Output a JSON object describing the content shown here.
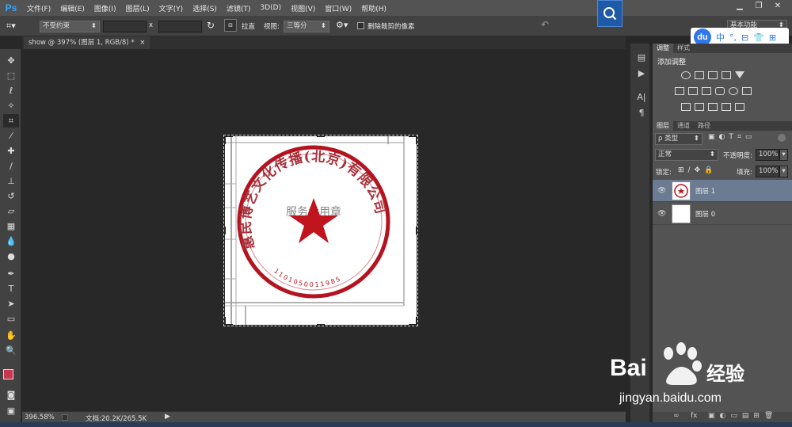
{
  "app": {
    "logo": "Ps"
  },
  "menu": [
    "文件(F)",
    "编辑(E)",
    "图像(I)",
    "图层(L)",
    "文字(Y)",
    "选择(S)",
    "滤镜(T)",
    "3D(D)",
    "视图(V)",
    "窗口(W)",
    "帮助(H)"
  ],
  "window_controls": [
    "▁",
    "❐",
    "✕"
  ],
  "options": {
    "ratio": "不受约束",
    "times": "x",
    "straighten": "拉直",
    "view_label": "视图:",
    "view_value": "三等分",
    "delete_cropped": "删除裁剪的像素",
    "workspace": "基本功能"
  },
  "document": {
    "tab": "show @ 397% (图层 1, RGB/8) *",
    "close": "×"
  },
  "status": {
    "zoom": "396.58%",
    "doc": "文档:20.2K/265.5K"
  },
  "du_bar": {
    "logo": "du",
    "items": [
      "中",
      "°,",
      "⊟",
      "👕",
      "⊞"
    ]
  },
  "adjustments": {
    "tabs": [
      "调整",
      "样式"
    ],
    "title": "添加调整"
  },
  "layers_panel": {
    "tabs": [
      "图层",
      "通道",
      "路径"
    ],
    "filter": "ρ 类型",
    "blend": "正常",
    "opacity_label": "不透明度:",
    "opacity": "100%",
    "lock_label": "锁定:",
    "fill_label": "填充:",
    "fill": "100%",
    "layers": [
      {
        "name": "图层 1",
        "selected": true
      },
      {
        "name": "图层 0",
        "selected": false
      }
    ],
    "footer_icons": [
      "∞",
      "fx"
    ]
  },
  "stamp": {
    "ring_text": "惠民博艺文化传播(北京)有限公司",
    "center_text": "服务专用章",
    "number": "1101050011985"
  },
  "watermark": {
    "brand_left": "Bai",
    "brand_right": "经验",
    "url": "jingyan.baidu.com"
  },
  "colors": {
    "stamp_red": "#b4141f",
    "foreground": "#c8364f",
    "accent_blue": "#2f77ea"
  }
}
